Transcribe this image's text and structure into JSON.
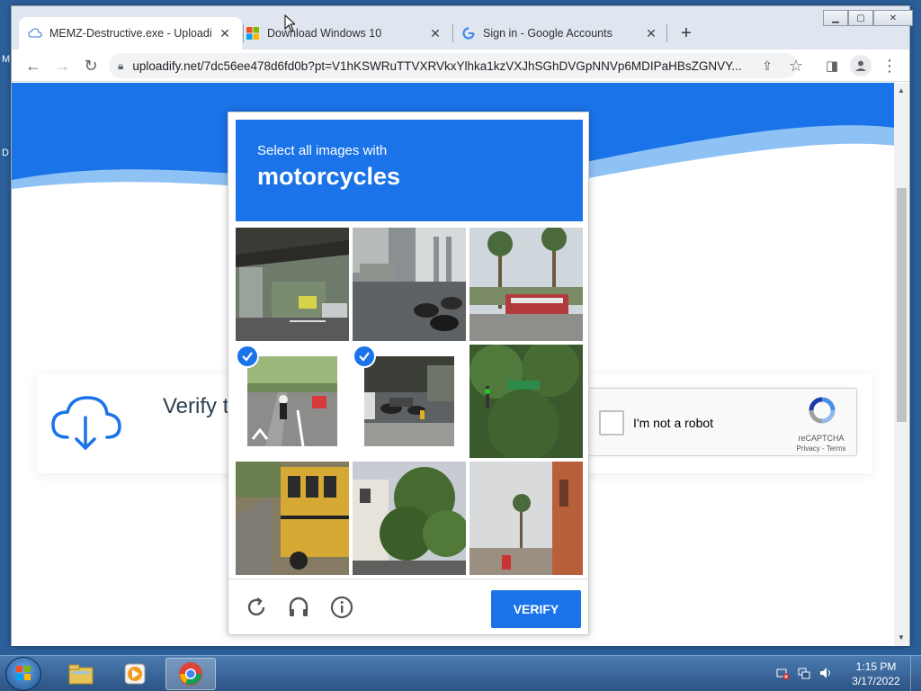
{
  "desktop": {
    "edge_glyphs": [
      "M",
      "D"
    ]
  },
  "browser": {
    "tabs": [
      {
        "title": "MEMZ-Destructive.exe - Uploadi",
        "favicon": "cloud-icon",
        "active": true
      },
      {
        "title": "Download Windows 10",
        "favicon": "windows-logo-icon",
        "active": false
      },
      {
        "title": "Sign in - Google Accounts",
        "favicon": "google-g-icon",
        "active": false
      }
    ],
    "new_tab_label": "+",
    "url": "uploadify.net/7dc56ee478d6fd0b?pt=V1hKSWRuTTVXRVkxYlhka1kzVXJhSGhDVGpNNVp6MDIPaHBsZGNVY...",
    "window_controls": [
      "minimize",
      "maximize",
      "close"
    ]
  },
  "page": {
    "verify_title": "Verify the",
    "recaptcha": {
      "label": "I'm not a robot",
      "brand": "reCAPTCHA",
      "links": "Privacy - Terms"
    }
  },
  "challenge": {
    "subtitle": "Select all images with",
    "object": "motorcycles",
    "tiles": [
      {
        "scene": "elevated-train-street",
        "selected": false
      },
      {
        "scene": "parked-motorcycles-street",
        "selected": false
      },
      {
        "scene": "palm-trees-red-bus",
        "selected": false
      },
      {
        "scene": "motorcycle-rider-lane",
        "selected": true
      },
      {
        "scene": "parked-motorcycle-night",
        "selected": true
      },
      {
        "scene": "tree-street-sign",
        "selected": false
      },
      {
        "scene": "yellow-school-bus",
        "selected": false
      },
      {
        "scene": "tree-house",
        "selected": false
      },
      {
        "scene": "palm-tree-building",
        "selected": false
      }
    ],
    "verify_label": "VERIFY",
    "footer_icons": [
      "reload-icon",
      "headphones-icon",
      "info-icon"
    ]
  },
  "taskbar": {
    "apps": [
      "file-explorer-icon",
      "media-player-icon",
      "chrome-icon"
    ],
    "active_app": "chrome-icon",
    "tray_icons": [
      "network-error-icon",
      "network-icon",
      "volume-icon"
    ],
    "clock_time": "1:15 PM",
    "clock_date": "3/17/2022"
  },
  "colors": {
    "captcha_blue": "#1a73e8",
    "taskbar": "#2c5485",
    "desktop": "#2b5f9a",
    "hero_blue": "#1a73e8"
  }
}
